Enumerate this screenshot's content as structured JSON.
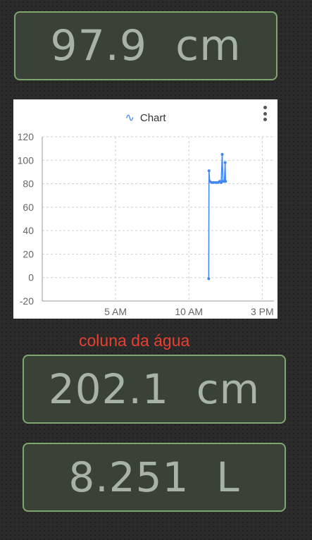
{
  "displays": {
    "depth": "97.9  cm",
    "water_column": "202.1  cm",
    "volume": "8.251  L"
  },
  "water_column_label": "coluna da água",
  "chart_data": {
    "type": "line",
    "title": "",
    "legend": [
      "Chart"
    ],
    "legend_placement": "top-center",
    "grid": true,
    "ylim": [
      -20,
      120
    ],
    "yticks": [
      -20,
      0,
      20,
      40,
      60,
      80,
      100,
      120
    ],
    "xlim_hours": [
      0,
      15.8
    ],
    "xticks": [
      {
        "label": "5 AM",
        "hour": 5
      },
      {
        "label": "10 AM",
        "hour": 10
      },
      {
        "label": "3 PM",
        "hour": 15
      }
    ],
    "series": [
      {
        "name": "Chart",
        "color": "#4285f4",
        "points": [
          {
            "hour": 11.35,
            "value": -1
          },
          {
            "hour": 11.37,
            "value": 91
          },
          {
            "hour": 11.42,
            "value": 82
          },
          {
            "hour": 11.55,
            "value": 81
          },
          {
            "hour": 11.7,
            "value": 81
          },
          {
            "hour": 11.85,
            "value": 81
          },
          {
            "hour": 12.0,
            "value": 81
          },
          {
            "hour": 12.1,
            "value": 82
          },
          {
            "hour": 12.2,
            "value": 81
          },
          {
            "hour": 12.27,
            "value": 105
          },
          {
            "hour": 12.32,
            "value": 82
          },
          {
            "hour": 12.42,
            "value": 82
          },
          {
            "hour": 12.47,
            "value": 98
          },
          {
            "hour": 12.5,
            "value": 82
          }
        ]
      }
    ]
  }
}
